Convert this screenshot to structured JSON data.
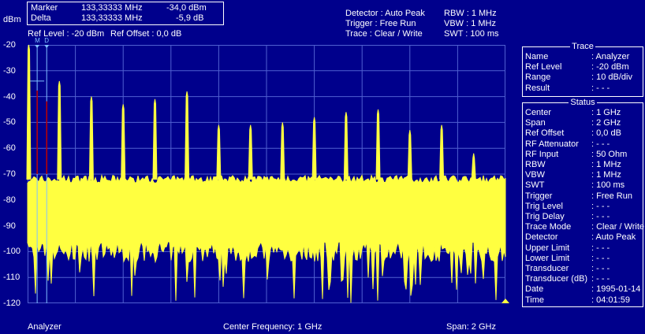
{
  "header": {
    "unit": "dBm",
    "marker": {
      "marker_label": "Marker",
      "marker_freq": "133,33333 MHz",
      "marker_level": "-34,0 dBm",
      "delta_label": "Delta",
      "delta_freq": "133,33333 MHz",
      "delta_level": "-5,9 dB"
    },
    "ref_level": "Ref Level : -20  dBm",
    "ref_offset": "Ref Offset : 0,0 dB",
    "detector": "Detector : Auto Peak",
    "trigger": "Trigger   : Free Run",
    "trace": "Trace     : Clear / Write",
    "rbw": "RBW :   1 MHz",
    "vbw": "VBW :   1 MHz",
    "swt": "SWT : 100 ms"
  },
  "y_axis_labels": [
    "-20",
    "-30",
    "-40",
    "-50",
    "-60",
    "-70",
    "-80",
    "-90",
    "-100",
    "-110",
    "-120"
  ],
  "marker_tags": {
    "m": "M",
    "d": "D"
  },
  "trace_panel": {
    "title": "Trace",
    "rows": [
      {
        "label": "Name",
        "value": ": Analyzer"
      },
      {
        "label": "Ref Level",
        "value": ":  -20     dBm"
      },
      {
        "label": "Range",
        "value": ": 10 dB/div"
      },
      {
        "label": "Result",
        "value": ": - - -"
      }
    ]
  },
  "status_panel": {
    "title": "Status",
    "rows": [
      {
        "label": "Center",
        "value": ":    1     GHz"
      },
      {
        "label": "Span",
        "value": ":    2     GHz"
      },
      {
        "label": "Ref Offset",
        "value": ":    0,0   dB"
      },
      {
        "label": "RF Attenuator",
        "value": ": - - -"
      },
      {
        "label": "RF Input",
        "value": ":   50    Ohm"
      },
      {
        "label": "RBW",
        "value": ":    1     MHz"
      },
      {
        "label": "VBW",
        "value": ":    1     MHz"
      },
      {
        "label": "SWT",
        "value": ":  100    ms"
      },
      {
        "label": "Trigger",
        "value": ": Free Run"
      },
      {
        "label": "Trig Level",
        "value": ": - - -"
      },
      {
        "label": "Trig Delay",
        "value": ": - - -"
      },
      {
        "label": "Trace Mode",
        "value": ": Clear / Write"
      },
      {
        "label": "Detector",
        "value": ": Auto Peak"
      },
      {
        "label": "Upper Limit",
        "value": ": - - -"
      },
      {
        "label": "Lower Limit",
        "value": ": - - -"
      },
      {
        "label": "Transducer",
        "value": ": - - -"
      },
      {
        "label": "Transducer (dB)",
        "value": ": - - -"
      },
      {
        "label": "Date",
        "value": ": 1995-01-14"
      },
      {
        "label": "Time",
        "value": ":  04:01:59"
      }
    ]
  },
  "footer": {
    "left": "Analyzer",
    "center": "Center Frequency:  1 GHz",
    "right": "Span:  2 GHz"
  },
  "colors": {
    "background": "#00008c",
    "trace": "#ffff40",
    "grid": "#5060d0",
    "marker_line": "#80c0ff",
    "marker_peak": "#c00000"
  },
  "chart_data": {
    "type": "line",
    "ylim": [
      -120,
      -20
    ],
    "xlim_ghz": [
      0,
      2
    ],
    "noise_floor_dbm": [
      -72,
      -100
    ],
    "marker_freq_mhz": 133.33333,
    "spur_peaks": [
      {
        "freq_ghz": 0.0,
        "level_dbm": -20
      },
      {
        "freq_ghz": 0.133,
        "level_dbm": -34
      },
      {
        "freq_ghz": 0.267,
        "level_dbm": -40
      },
      {
        "freq_ghz": 0.4,
        "level_dbm": -43
      },
      {
        "freq_ghz": 0.533,
        "level_dbm": -41
      },
      {
        "freq_ghz": 0.667,
        "level_dbm": -38
      },
      {
        "freq_ghz": 0.8,
        "level_dbm": -51
      },
      {
        "freq_ghz": 0.933,
        "level_dbm": -51
      },
      {
        "freq_ghz": 1.067,
        "level_dbm": -50
      },
      {
        "freq_ghz": 1.2,
        "level_dbm": -48
      },
      {
        "freq_ghz": 1.333,
        "level_dbm": -46
      },
      {
        "freq_ghz": 1.467,
        "level_dbm": -45
      },
      {
        "freq_ghz": 1.6,
        "level_dbm": -53
      },
      {
        "freq_ghz": 1.733,
        "level_dbm": -51
      },
      {
        "freq_ghz": 1.867,
        "level_dbm": -62
      }
    ]
  }
}
